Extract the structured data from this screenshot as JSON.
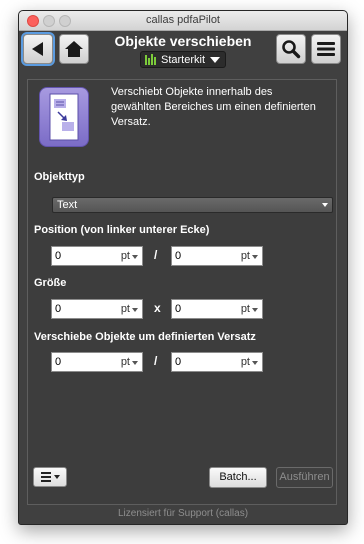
{
  "window": {
    "title": "callas pdfaPilot"
  },
  "header": {
    "title": "Objekte verschieben",
    "profile": "Starterkit"
  },
  "description": "Verschiebt Objekte innerhalb des gewählten Bereiches um einen definierten Versatz.",
  "object_type": {
    "label": "Objekttyp",
    "value": "Text"
  },
  "position": {
    "label": "Position (von linker unterer Ecke)",
    "x": "0",
    "x_unit": "pt",
    "separator": "/",
    "y": "0",
    "y_unit": "pt"
  },
  "size": {
    "label": "Größe",
    "w": "0",
    "w_unit": "pt",
    "separator": "x",
    "h": "0",
    "h_unit": "pt"
  },
  "offset": {
    "label": "Verschiebe Objekte um definierten Versatz",
    "x": "0",
    "x_unit": "pt",
    "separator": "/",
    "y": "0",
    "y_unit": "pt"
  },
  "buttons": {
    "batch": "Batch...",
    "run": "Ausführen"
  },
  "footer": "Lizensiert für Support (callas)",
  "icons": [
    "back-icon",
    "home-icon",
    "search-icon",
    "menu-icon",
    "bar-chart-icon",
    "move-objects-icon",
    "hamburger-icon"
  ],
  "colors": {
    "background": "#404040",
    "accent": "#7ccc3a",
    "focus": "#5a9be0",
    "icon": "#8b7ad6"
  }
}
